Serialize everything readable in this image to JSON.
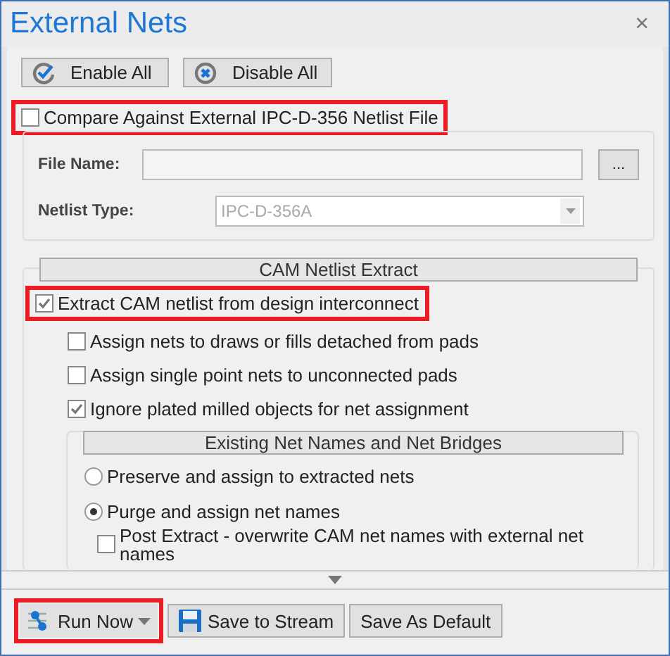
{
  "window": {
    "title": "External Nets",
    "close": "×"
  },
  "toolbar": [
    {
      "label": "Enable All",
      "kind": "enable"
    },
    {
      "label": "Disable All",
      "kind": "disable"
    }
  ],
  "compare": {
    "label": "Compare Against External IPC-D-356 Netlist File",
    "checked": false,
    "highlighted": true
  },
  "file_name": {
    "label": "File Name:",
    "browse": "..."
  },
  "netlist_type": {
    "label": "Netlist Type:",
    "value": "IPC-D-356A",
    "disabled": true
  },
  "cam_extract": {
    "title": "CAM Netlist Extract",
    "extract": {
      "label": "Extract CAM netlist from design interconnect",
      "checked": true,
      "highlighted": true
    },
    "options": [
      {
        "label": "Assign nets to draws or fills detached from pads",
        "checked": false
      },
      {
        "label": "Assign single point nets to unconnected pads",
        "checked": false
      },
      {
        "label": "Ignore plated milled objects for net assignment",
        "checked": true
      }
    ],
    "bridges": {
      "title": "Existing Net Names and Net Bridges",
      "options": [
        {
          "label": "Preserve and assign to extracted nets",
          "selected": false
        },
        {
          "label": "Purge and assign net names",
          "selected": true
        }
      ],
      "post_extract": {
        "label": "Post Extract - overwrite CAM net names with external net names",
        "checked": false
      }
    }
  },
  "actions": [
    {
      "label": "Run Now",
      "kind": "run",
      "highlighted": true
    },
    {
      "label": "Save to Stream",
      "kind": "save",
      "highlighted": false
    },
    {
      "label": "Save As Default",
      "kind": "plain",
      "highlighted": false
    }
  ]
}
